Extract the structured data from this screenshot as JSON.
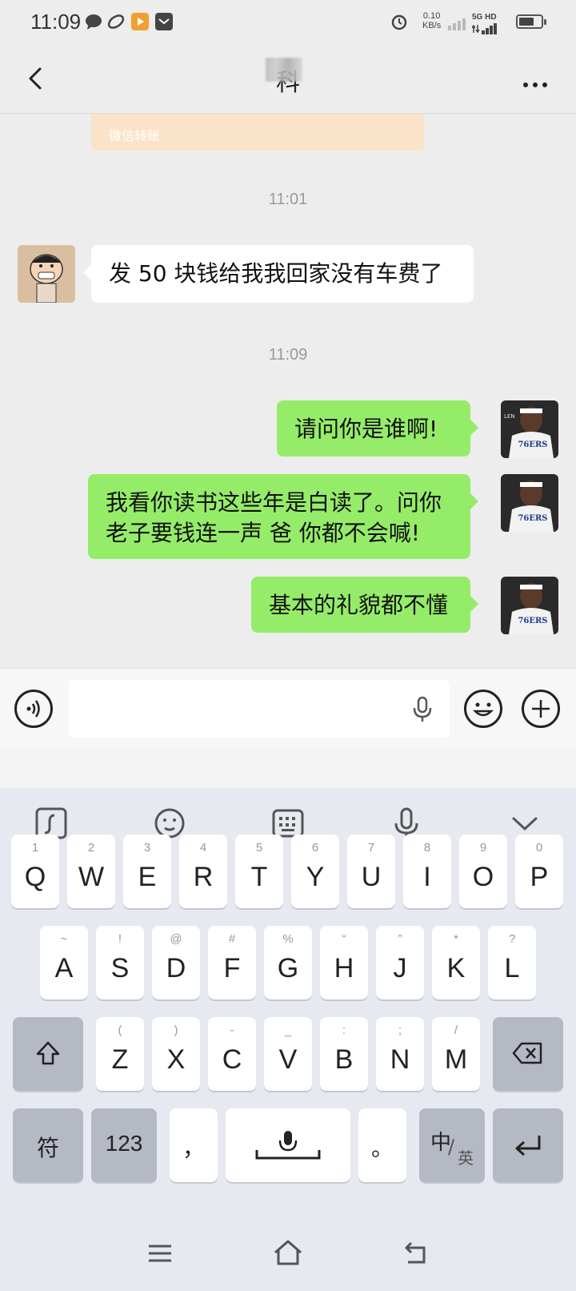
{
  "status_bar": {
    "time": "11:09",
    "net_speed_value": "0.10",
    "net_speed_unit": "KB/s",
    "network_label": "5G HD"
  },
  "header": {
    "title": "科"
  },
  "chat": {
    "transfer_label": "微信转账",
    "timestamps": [
      "11:01",
      "11:09"
    ],
    "messages": [
      {
        "side": "left",
        "text": "发 50 块钱给我我回家没有车费了"
      },
      {
        "side": "right",
        "text": "请问你是谁啊!"
      },
      {
        "side": "right",
        "line1": "我看你读书这些年是白读了。问你",
        "line2": "老子要钱连一声 爸 你都不会喊!"
      },
      {
        "side": "right",
        "text": "基本的礼貌都不懂"
      }
    ]
  },
  "keyboard": {
    "row1": [
      {
        "num": "1",
        "key": "Q"
      },
      {
        "num": "2",
        "key": "W"
      },
      {
        "num": "3",
        "key": "E"
      },
      {
        "num": "4",
        "key": "R"
      },
      {
        "num": "5",
        "key": "T"
      },
      {
        "num": "6",
        "key": "Y"
      },
      {
        "num": "7",
        "key": "U"
      },
      {
        "num": "8",
        "key": "I"
      },
      {
        "num": "9",
        "key": "O"
      },
      {
        "num": "0",
        "key": "P"
      }
    ],
    "row2": [
      {
        "sym": "~",
        "key": "A"
      },
      {
        "sym": "!",
        "key": "S"
      },
      {
        "sym": "@",
        "key": "D"
      },
      {
        "sym": "#",
        "key": "F"
      },
      {
        "sym": "%",
        "key": "G"
      },
      {
        "sym": "“",
        "key": "H"
      },
      {
        "sym": "”",
        "key": "J"
      },
      {
        "sym": "*",
        "key": "K"
      },
      {
        "sym": "?",
        "key": "L"
      }
    ],
    "row3": [
      {
        "sym": "(",
        "key": "Z"
      },
      {
        "sym": ")",
        "key": "X"
      },
      {
        "sym": "-",
        "key": "C"
      },
      {
        "sym": "_",
        "key": "V"
      },
      {
        "sym": ":",
        "key": "B"
      },
      {
        "sym": ";",
        "key": "N"
      },
      {
        "sym": "/",
        "key": "M"
      }
    ],
    "symbols_label": "符",
    "numbers_label": "123",
    "comma_label": "，",
    "period_label": "。",
    "lang_main": "中",
    "lang_sub": "英"
  },
  "icons": [
    "chat-bubble-icon",
    "app-icon",
    "video-app-icon",
    "mail-icon",
    "alarm-icon",
    "back-arrow-icon",
    "more-icon",
    "voice-icon",
    "microphone-icon",
    "emoji-icon",
    "plus-icon",
    "handwriting-icon",
    "keyboard-icon",
    "collapse-icon",
    "shift-icon",
    "backspace-icon",
    "enter-icon",
    "menu-icon",
    "home-icon",
    "back-nav-icon"
  ],
  "colors": {
    "sent_bubble": "#95ec69",
    "received_bubble": "#ffffff",
    "chat_background": "#ededed",
    "keyboard_background": "#e6e9ef"
  }
}
